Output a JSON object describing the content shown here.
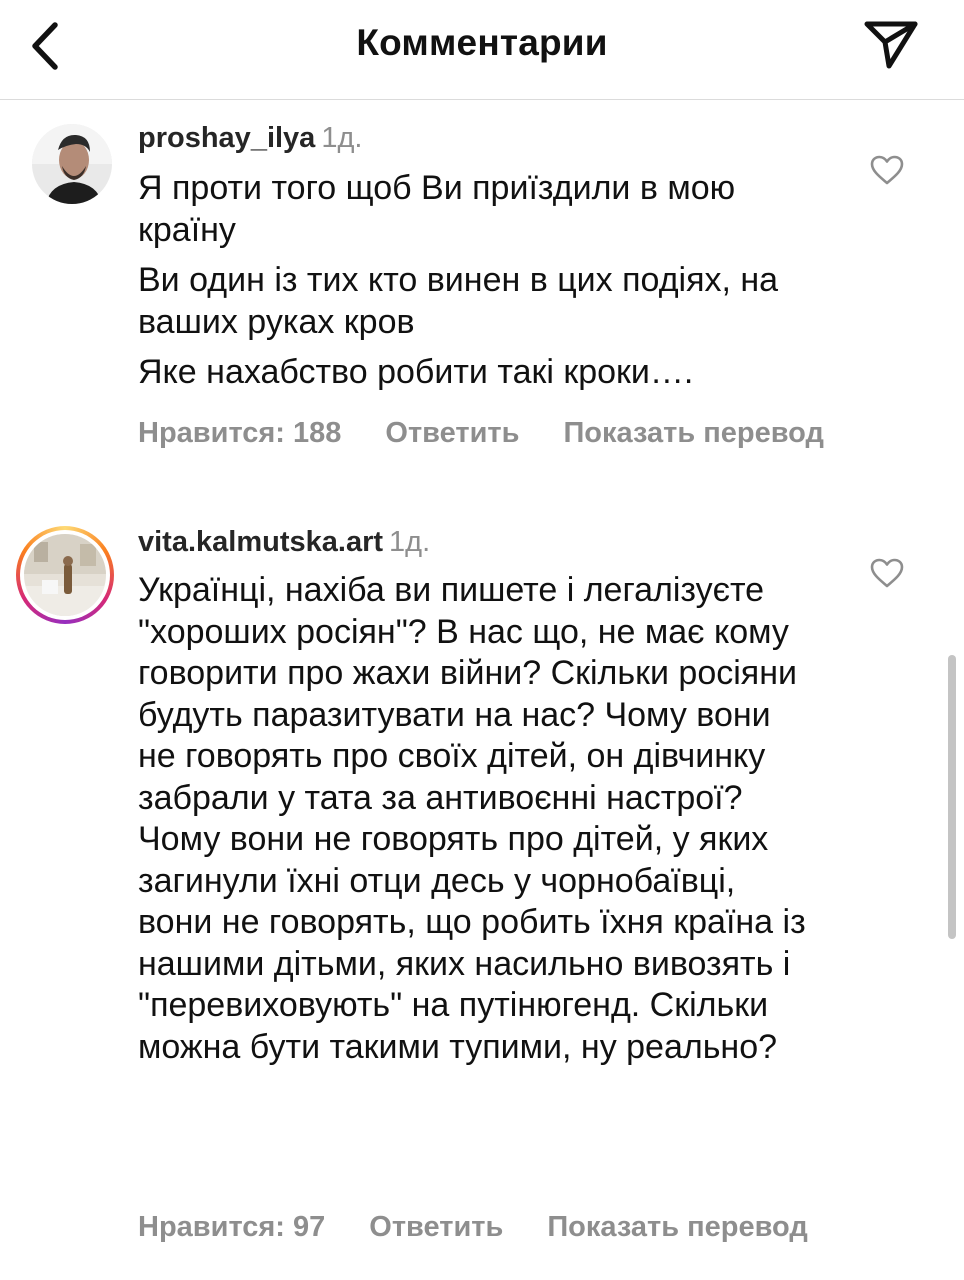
{
  "header": {
    "title": "Комментарии",
    "back_icon": "chevron-left-icon",
    "share_icon": "paper-plane-icon"
  },
  "comments": [
    {
      "username": "proshay_ilya",
      "time": "1д.",
      "paragraphs": [
        "Я проти того щоб Ви приїздили в мою країну",
        "Ви один із тих кто винен в цих подіях, на ваших руках кров",
        "Яке нахабство робити такі кроки…."
      ],
      "likes_label": "Нравится: 188",
      "reply_label": "Ответить",
      "translate_label": "Показать перевод"
    },
    {
      "username": "vita.kalmutska.art",
      "time": "1д.",
      "paragraphs": [
        "Українці, нахіба ви пишете і легалізуєте \"хороших росіян\"? В нас що, не має кому говорити про жахи війни? Скільки росіяни будуть паразитувати на нас? Чому вони не говорять про своїх дітей, он дівчинку забрали у тата за антивоєнні настрої? Чому вони не говорять про дітей, у яких загинули їхні отци десь у чорнобаївці, вони не говорять, що робить їхня країна із нашими дітьми, яких насильно вивозять і \"перевиховують\" на путінюгенд. Скільки можна бути такими тупими, ну реально?"
      ],
      "likes_label": "Нравится: 97",
      "reply_label": "Ответить",
      "translate_label": "Показать перевод"
    }
  ],
  "colors": {
    "text": "#111111",
    "secondary": "#8e8e8e",
    "divider": "#dbdbdb"
  }
}
